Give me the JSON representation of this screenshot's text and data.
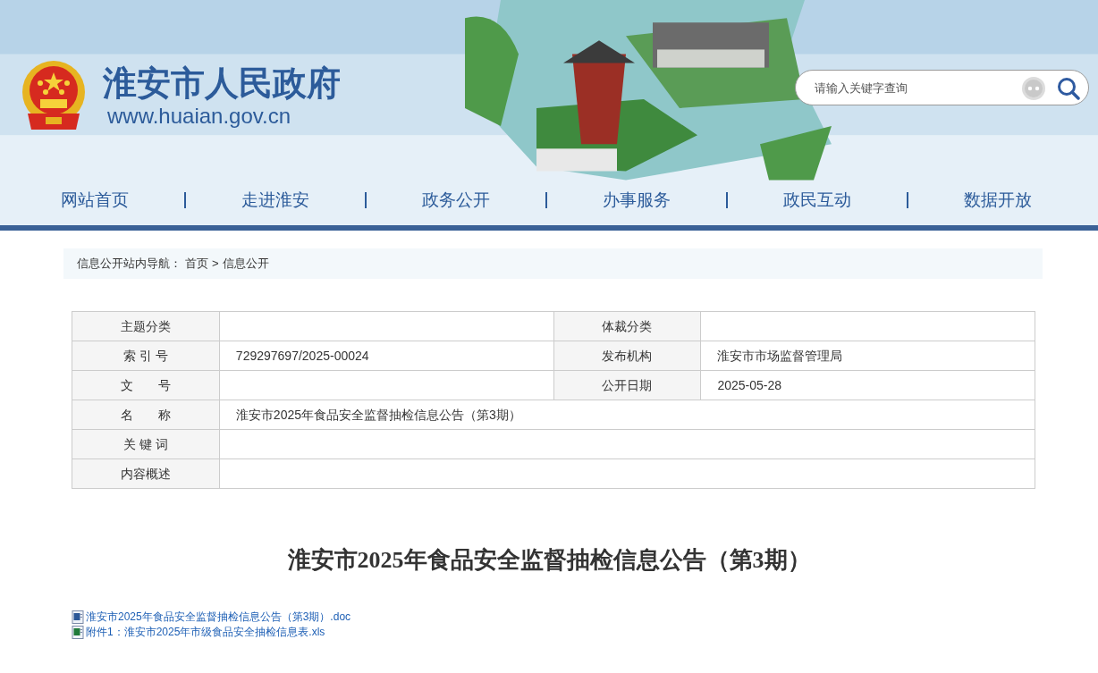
{
  "site": {
    "title": "淮安市人民政府",
    "url": "www.huaian.gov.cn"
  },
  "search": {
    "placeholder": "请输入关键字查询"
  },
  "nav": [
    {
      "label": "网站首页"
    },
    {
      "label": "走进淮安"
    },
    {
      "label": "政务公开"
    },
    {
      "label": "办事服务"
    },
    {
      "label": "政民互动"
    },
    {
      "label": "数据开放"
    }
  ],
  "breadcrumb": {
    "label": "信息公开站内导航：",
    "items": [
      "首页",
      "信息公开"
    ],
    "separator": ">"
  },
  "meta": [
    {
      "cells": [
        {
          "label": "主题分类"
        },
        {
          "label": "体裁分类"
        }
      ]
    },
    {
      "cells": [
        {
          "label": "索 引 号",
          "value": "729297697/2025-00024"
        },
        {
          "label": "发布机构",
          "value": "淮安市市场监督管理局"
        }
      ]
    },
    {
      "cells": [
        {
          "label": "文　　号"
        },
        {
          "label": "公开日期",
          "value": "2025-05-28"
        }
      ]
    },
    {
      "cells": [
        {
          "label": "名　　称",
          "value": "淮安市2025年食品安全监督抽检信息公告（第3期）"
        }
      ]
    },
    {
      "cells": [
        {
          "label": "关 键 词"
        }
      ]
    },
    {
      "cells": [
        {
          "label": "内容概述"
        }
      ]
    }
  ],
  "title": "淮安市2025年食品安全监督抽检信息公告（第3期）",
  "attachments": [
    {
      "kind": "doc",
      "label": "淮安市2025年食品安全监督抽检信息公告（第3期）.doc"
    },
    {
      "kind": "xls",
      "label": "附件1：淮安市2025年市级食品安全抽检信息表.xls"
    }
  ]
}
